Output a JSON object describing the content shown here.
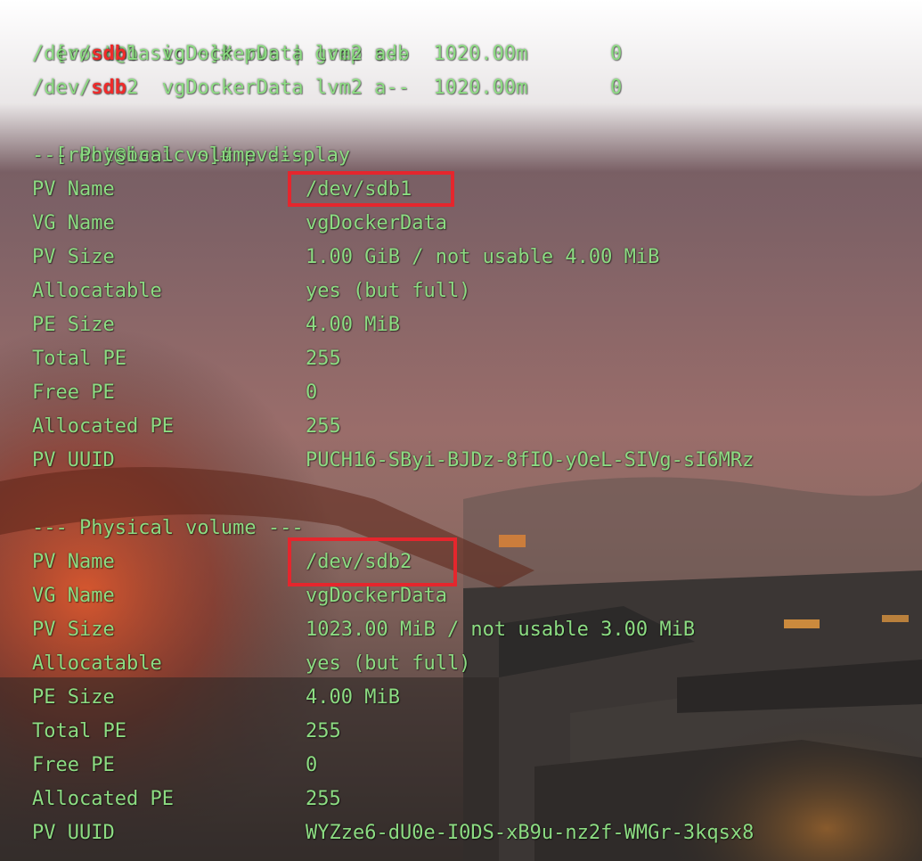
{
  "colors": {
    "terminal_text": "#8cdc82",
    "highlight_text": "#ee2b2b",
    "annotation_box": "#e5262d"
  },
  "commands": {
    "pvs_prompt": "[root@basic ~]# pvs | grep sdb",
    "pvdisplay_prompt": "[root@basic ~]# pvdisplay"
  },
  "pvs_rows": [
    {
      "prefix": "/dev/",
      "highlight": "sdb",
      "suffix": "1  vgDockerData lvm2 a--  1020.00m       0"
    },
    {
      "prefix": "/dev/",
      "highlight": "sdb",
      "suffix": "2  vgDockerData lvm2 a--  1020.00m       0"
    }
  ],
  "volumes": [
    {
      "header": "--- Physical volume ---",
      "fields": [
        {
          "label": "PV Name",
          "value": "/dev/sdb1"
        },
        {
          "label": "VG Name",
          "value": "vgDockerData"
        },
        {
          "label": "PV Size",
          "value": "1.00 GiB / not usable 4.00 MiB"
        },
        {
          "label": "Allocatable",
          "value": "yes (but full)"
        },
        {
          "label": "PE Size",
          "value": "4.00 MiB"
        },
        {
          "label": "Total PE",
          "value": "255"
        },
        {
          "label": "Free PE",
          "value": "0"
        },
        {
          "label": "Allocated PE",
          "value": "255"
        },
        {
          "label": "PV UUID",
          "value": "PUCH16-SByi-BJDz-8fIO-yOeL-SIVg-sI6MRz"
        }
      ]
    },
    {
      "header": "--- Physical volume ---",
      "fields": [
        {
          "label": "PV Name",
          "value": "/dev/sdb2"
        },
        {
          "label": "VG Name",
          "value": "vgDockerData"
        },
        {
          "label": "PV Size",
          "value": "1023.00 MiB / not usable 3.00 MiB"
        },
        {
          "label": "Allocatable",
          "value": "yes (but full)"
        },
        {
          "label": "PE Size",
          "value": "4.00 MiB"
        },
        {
          "label": "Total PE",
          "value": "255"
        },
        {
          "label": "Free PE",
          "value": "0"
        },
        {
          "label": "Allocated PE",
          "value": "255"
        },
        {
          "label": "PV UUID",
          "value": "WYZze6-dU0e-I0DS-xB9u-nz2f-WMGr-3kqsx8"
        }
      ]
    }
  ]
}
